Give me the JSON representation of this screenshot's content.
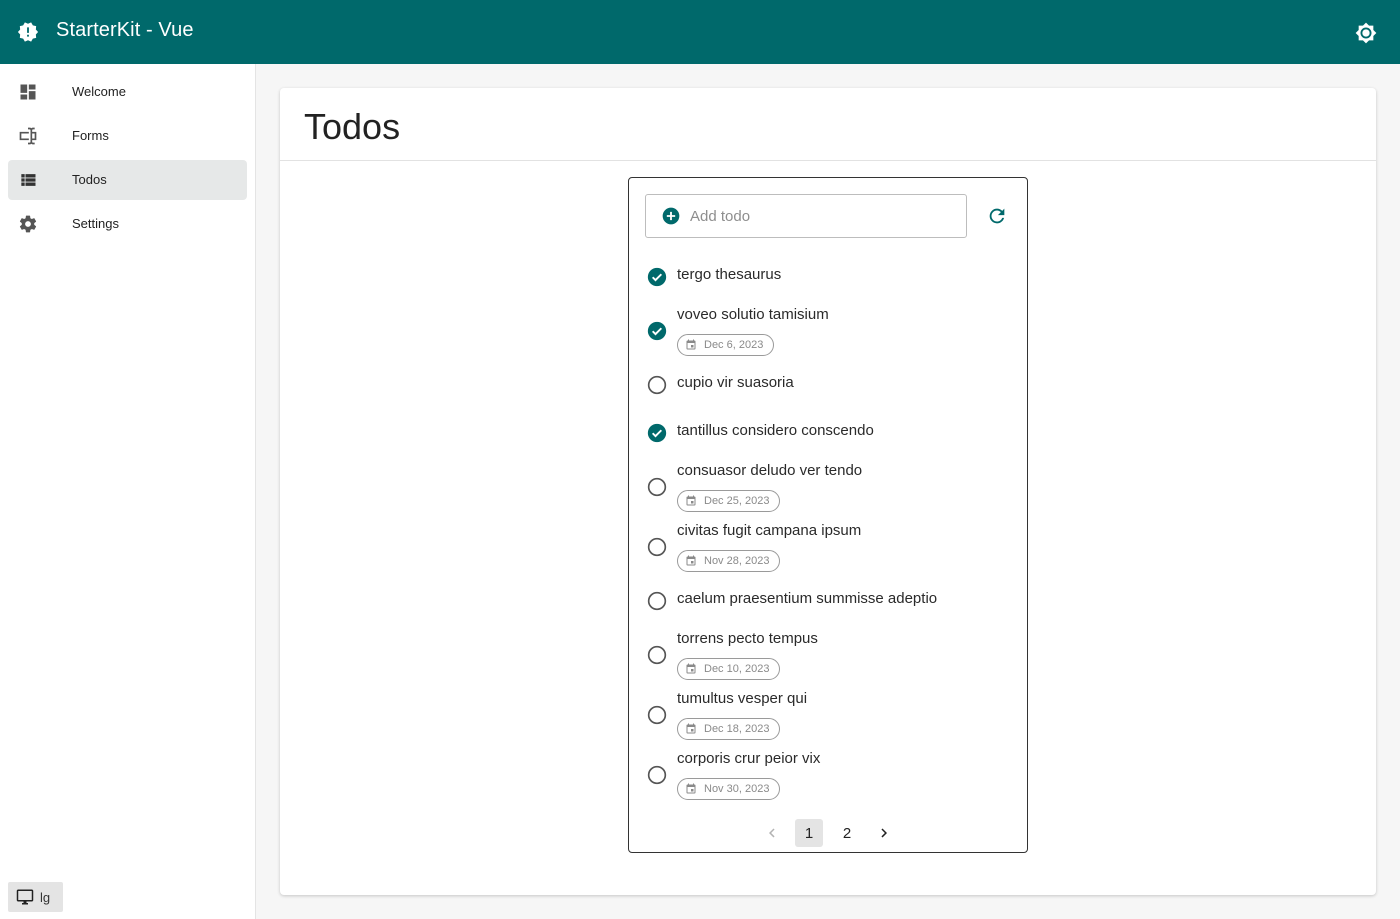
{
  "app": {
    "title": "StarterKit - Vue",
    "accent_color": "#00696b",
    "logo_icon": "alert-decagram-icon",
    "theme_toggle_icon": "brightness-icon"
  },
  "sidebar": {
    "items": [
      {
        "label": "Welcome",
        "icon": "dashboard-icon",
        "active": false
      },
      {
        "label": "Forms",
        "icon": "form-textbox-icon",
        "active": false
      },
      {
        "label": "Todos",
        "icon": "view-list-icon",
        "active": true
      },
      {
        "label": "Settings",
        "icon": "gear-icon",
        "active": false
      }
    ],
    "breakpoint": {
      "icon": "monitor-icon",
      "label": "lg"
    }
  },
  "main": {
    "page_title": "Todos",
    "add_todo": {
      "placeholder": "Add todo",
      "value": ""
    },
    "todos": [
      {
        "text": "tergo thesaurus",
        "done": true,
        "date": ""
      },
      {
        "text": "voveo solutio tamisium",
        "done": true,
        "date": "Dec 6, 2023"
      },
      {
        "text": "cupio vir suasoria",
        "done": false,
        "date": ""
      },
      {
        "text": "tantillus considero conscendo",
        "done": true,
        "date": ""
      },
      {
        "text": "consuasor deludo ver tendo",
        "done": false,
        "date": "Dec 25, 2023"
      },
      {
        "text": "civitas fugit campana ipsum",
        "done": false,
        "date": "Nov 28, 2023"
      },
      {
        "text": "caelum praesentium summisse adeptio",
        "done": false,
        "date": ""
      },
      {
        "text": "torrens pecto tempus",
        "done": false,
        "date": "Dec 10, 2023"
      },
      {
        "text": "tumultus vesper qui",
        "done": false,
        "date": "Dec 18, 2023"
      },
      {
        "text": "corporis crur peior vix",
        "done": false,
        "date": "Nov 30, 2023"
      }
    ],
    "pagination": {
      "pages": [
        "1",
        "2"
      ],
      "current": "1"
    }
  }
}
